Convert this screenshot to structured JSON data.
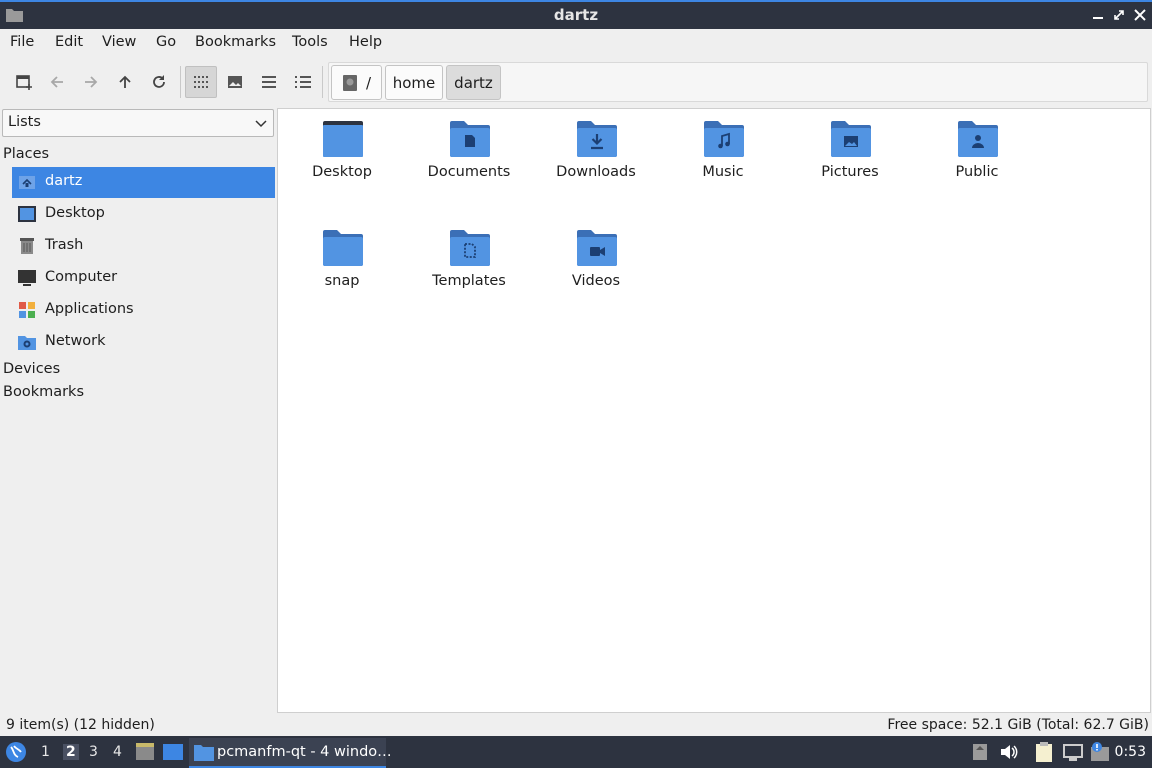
{
  "window": {
    "title": "dartz"
  },
  "menu": [
    "File",
    "Edit",
    "View",
    "Go",
    "Bookmarks",
    "Tools",
    "Help"
  ],
  "breadcrumb": [
    {
      "label": "/",
      "icon": "drive-icon"
    },
    {
      "label": "home"
    },
    {
      "label": "dartz"
    }
  ],
  "side": {
    "selector": "Lists",
    "sections": {
      "places": "Places",
      "devices": "Devices",
      "bookmarks": "Bookmarks"
    },
    "places": [
      {
        "label": "dartz",
        "icon": "home-icon"
      },
      {
        "label": "Desktop",
        "icon": "desktop-icon"
      },
      {
        "label": "Trash",
        "icon": "trash-icon"
      },
      {
        "label": "Computer",
        "icon": "computer-icon"
      },
      {
        "label": "Applications",
        "icon": "applications-icon"
      },
      {
        "label": "Network",
        "icon": "network-icon"
      }
    ]
  },
  "files": [
    {
      "name": "Desktop",
      "icon": "desktop-folder-icon"
    },
    {
      "name": "Documents",
      "icon": "documents-folder-icon"
    },
    {
      "name": "Downloads",
      "icon": "downloads-folder-icon"
    },
    {
      "name": "Music",
      "icon": "music-folder-icon"
    },
    {
      "name": "Pictures",
      "icon": "pictures-folder-icon"
    },
    {
      "name": "Public",
      "icon": "public-folder-icon"
    },
    {
      "name": "snap",
      "icon": "folder-icon"
    },
    {
      "name": "Templates",
      "icon": "templates-folder-icon"
    },
    {
      "name": "Videos",
      "icon": "videos-folder-icon"
    }
  ],
  "status": {
    "items": "9 item(s) (12 hidden)",
    "free_space": "Free space: 52.1 GiB (Total: 62.7 GiB)"
  },
  "taskbar": {
    "workspaces": [
      "1",
      "2",
      "3",
      "4"
    ],
    "current_workspace": "2",
    "task_label": "pcmanfm-qt - 4 windo…",
    "clock": "0:53"
  },
  "colors": {
    "accent": "#3d86e3",
    "folder": "#5294e2",
    "folder_dark": "#3b6fb6",
    "titlebar": "#2d3340"
  }
}
